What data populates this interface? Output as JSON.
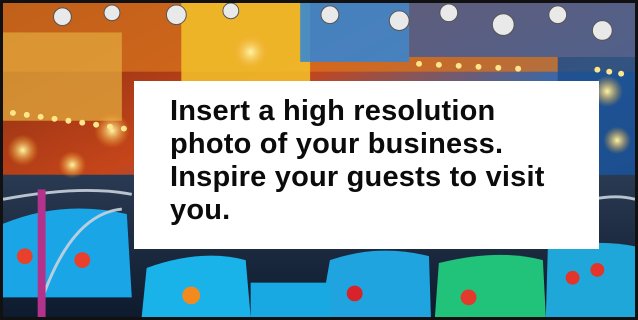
{
  "placeholder": {
    "headline": "Insert a high resolution photo of your business. Inspire your guests to visit you."
  },
  "colors": {
    "border": "#111111",
    "text_box_background": "#ffffff",
    "headline_text": "#0b0b0b"
  }
}
